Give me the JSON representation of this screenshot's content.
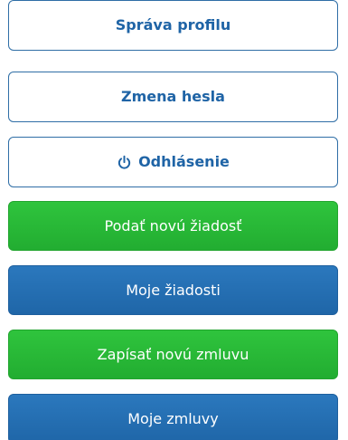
{
  "menu": {
    "profile_label": "Správa profilu",
    "password_label": "Zmena hesla",
    "logout_label": "Odhlásenie",
    "new_request_label": "Podať novú žiadosť",
    "my_requests_label": "Moje žiadosti",
    "new_contract_label": "Zapísať novú zmluvu",
    "my_contracts_label": "Moje zmluvy"
  },
  "icons": {
    "logout": "power-icon"
  },
  "colors": {
    "outline_text": "#1f64a6",
    "outline_border": "#2f6ea6",
    "green": "#26b534",
    "blue": "#236fb4",
    "white": "#ffffff"
  }
}
